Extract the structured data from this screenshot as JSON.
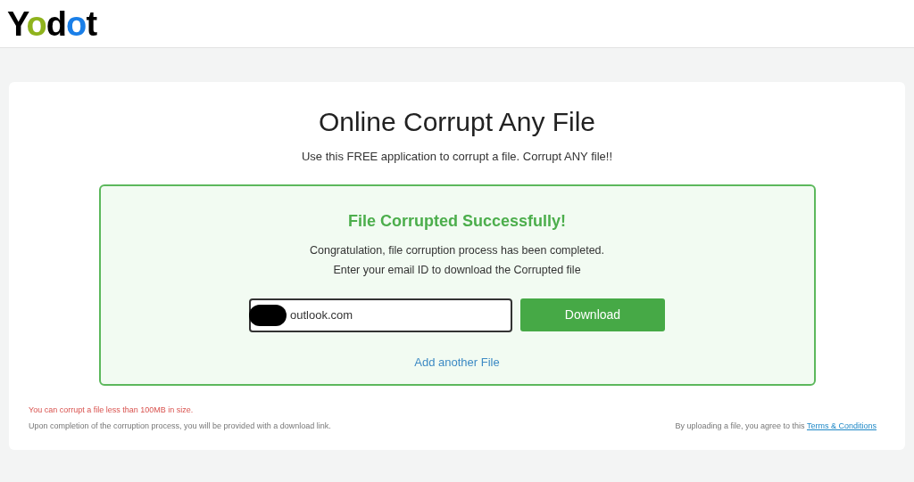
{
  "logo": {
    "text": "Yodot"
  },
  "page": {
    "title": "Online Corrupt Any File",
    "subtitle": "Use this FREE application to corrupt a file. Corrupt ANY file!!"
  },
  "result": {
    "heading": "File Corrupted Successfully!",
    "lines": [
      "Congratulation, file corruption process has been completed.",
      "Enter your email ID to download the Corrupted file"
    ],
    "email": {
      "value": "outlook.com",
      "redacted": true
    },
    "download_button": "Download",
    "add_link": "Add another File"
  },
  "footer": {
    "warning": "You can corrupt a file less than 100MB in size.",
    "note": "Upon completion of the corruption process, you will be provided with a download link.",
    "agree": "By uploading a file, you agree to this",
    "terms_link": "Terms & Conditions"
  }
}
